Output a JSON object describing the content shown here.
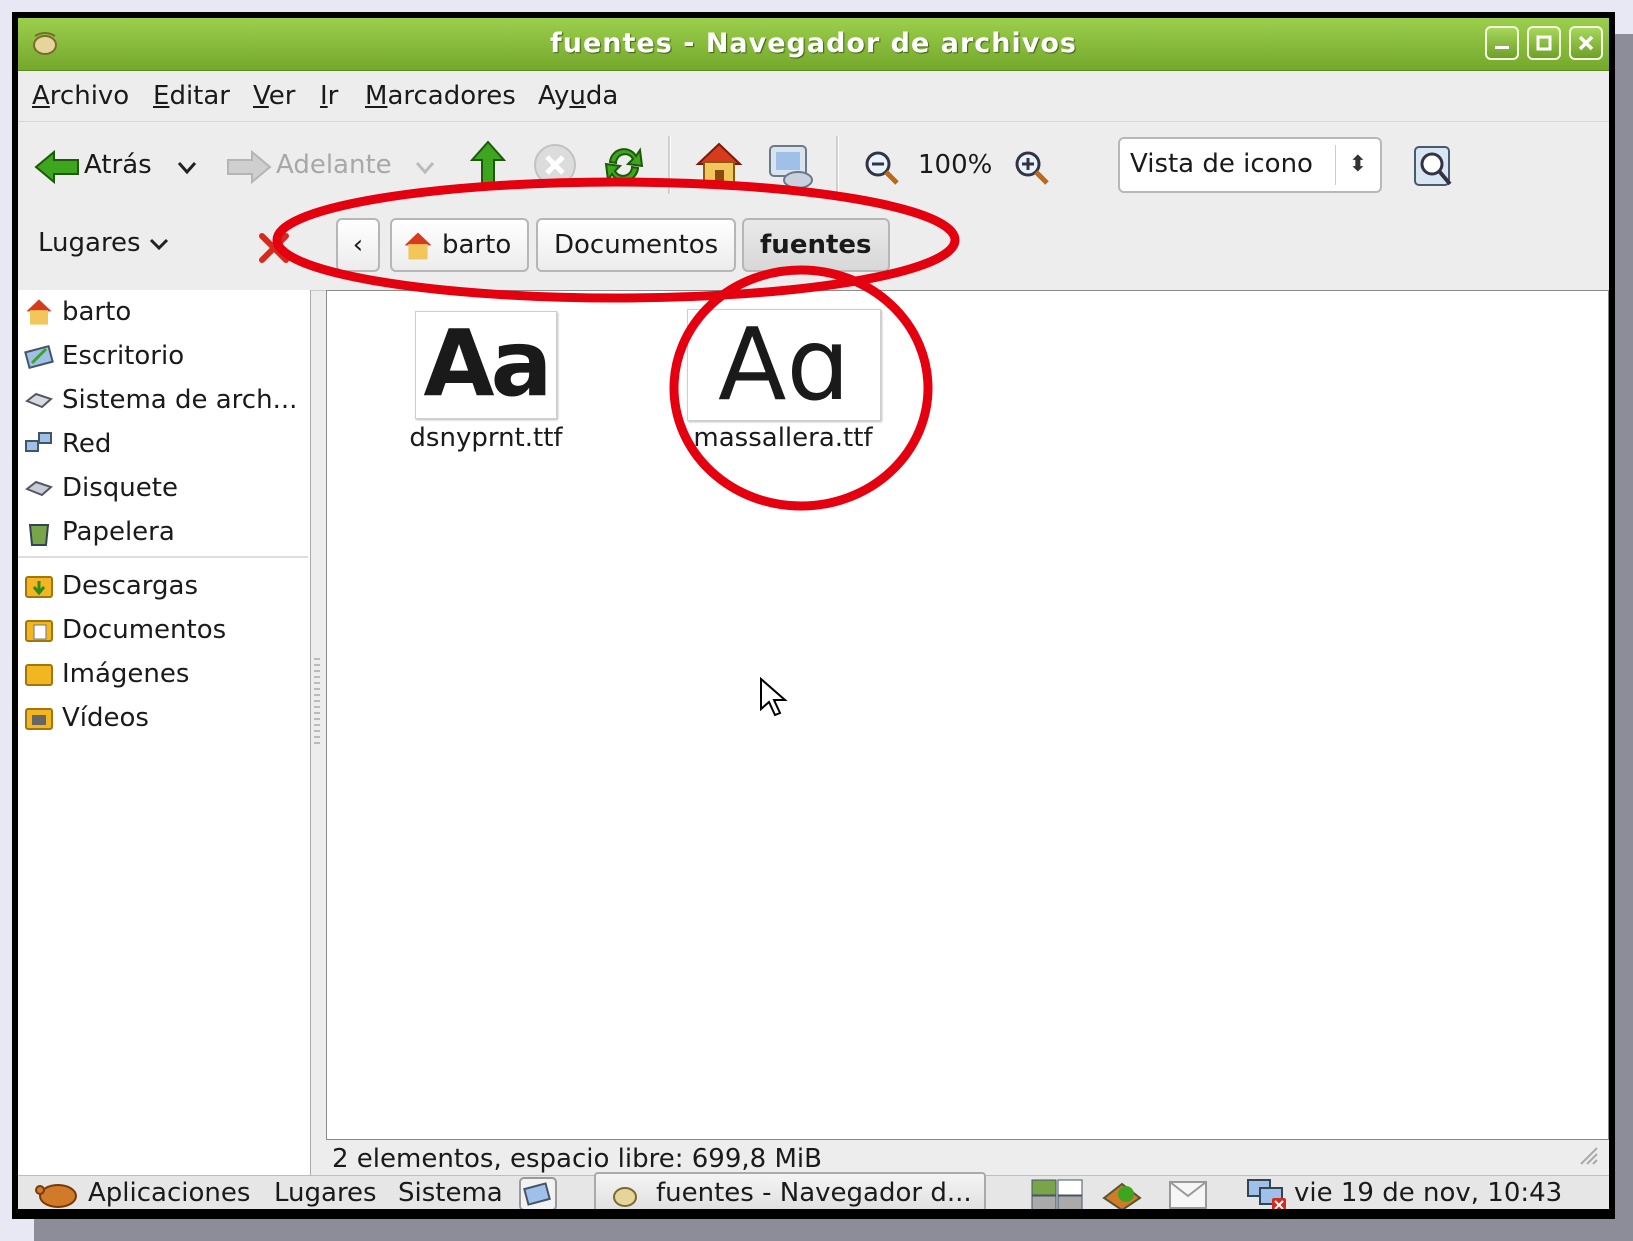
{
  "window": {
    "title": "fuentes - Navegador de archivos"
  },
  "menubar": {
    "items": [
      {
        "pre": "",
        "key": "A",
        "post": "rchivo"
      },
      {
        "pre": "",
        "key": "E",
        "post": "ditar"
      },
      {
        "pre": "",
        "key": "V",
        "post": "er"
      },
      {
        "pre": "",
        "key": "I",
        "post": "r"
      },
      {
        "pre": "",
        "key": "M",
        "post": "arcadores"
      },
      {
        "pre": "Ay",
        "key": "u",
        "post": "da"
      }
    ]
  },
  "toolbar": {
    "back_label": "Atrás",
    "forward_label": "Adelante",
    "zoom_level": "100%",
    "view_mode": "Vista de icono"
  },
  "location": {
    "places_label": "Lugares",
    "breadcrumbs": [
      "barto",
      "Documentos",
      "fuentes"
    ]
  },
  "sidebar": {
    "items": [
      "barto",
      "Escritorio",
      "Sistema de arch...",
      "Red",
      "Disquete",
      "Papelera"
    ],
    "bookmarks": [
      "Descargas",
      "Documentos",
      "Imágenes",
      "Vídeos"
    ]
  },
  "files": [
    {
      "name": "dsnyprnt.ttf",
      "preview": "Aa"
    },
    {
      "name": "massallera.ttf",
      "preview": "Aɑ"
    }
  ],
  "status": {
    "text": "2 elementos, espacio libre: 699,8 MiB"
  },
  "panel": {
    "applications": "Aplicaciones",
    "places": "Lugares",
    "system": "Sistema",
    "task": "fuentes - Navegador d...",
    "clock": "vie 19 de nov, 10:43"
  },
  "colors": {
    "titlebar": "#86bb3a",
    "annotation": "#e5000f"
  }
}
